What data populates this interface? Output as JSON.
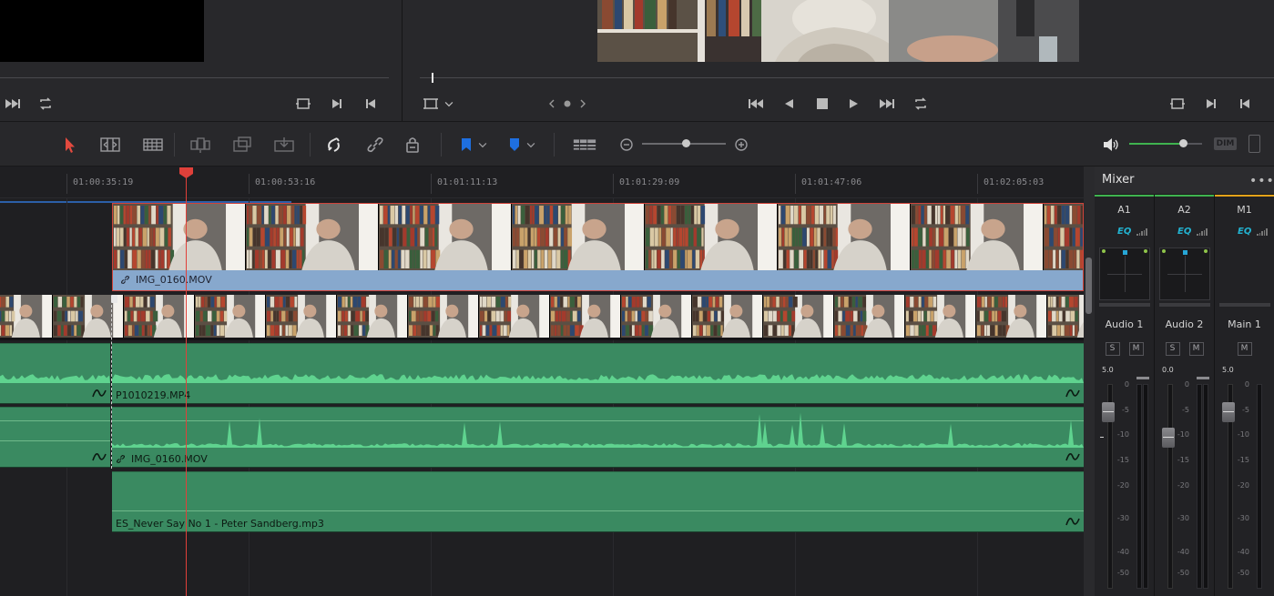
{
  "toolbar": {
    "tools": [
      {
        "name": "selection-mode-icon"
      },
      {
        "name": "trim-edit-mode-icon"
      },
      {
        "name": "dynamic-trim-mode-icon"
      },
      {
        "name": "blade-edit-mode-icon"
      },
      {
        "name": "insert-clip-icon"
      },
      {
        "name": "overwrite-clip-icon"
      },
      {
        "name": "replace-clip-icon"
      },
      {
        "name": "snapping-icon"
      },
      {
        "name": "linked-selection-icon"
      },
      {
        "name": "position-lock-icon"
      },
      {
        "name": "flag-icon"
      },
      {
        "name": "marker-icon"
      },
      {
        "name": "timeline-view-options-icon"
      },
      {
        "name": "zoom-out-icon"
      },
      {
        "name": "zoom-in-icon"
      },
      {
        "name": "speaker-icon"
      }
    ],
    "dim_label": "DIM",
    "zoom_level": 0.5,
    "volume_level": 0.74
  },
  "timeline": {
    "ruler_timecodes": [
      "01:00:35:19",
      "01:00:53:16",
      "01:01:11:13",
      "01:01:29:09",
      "01:01:47:06",
      "01:02:05:03"
    ],
    "video_clips": [
      {
        "name": "IMG_0160.MOV"
      }
    ],
    "audio_clips": [
      {
        "name": "P1010219.MP4"
      },
      {
        "name": "IMG_0160.MOV"
      },
      {
        "name": "ES_Never Say No 1 - Peter Sandberg.mp3"
      }
    ]
  },
  "mixer": {
    "title": "Mixer",
    "menu_label": "•••",
    "channels": [
      {
        "id": "A1",
        "name": "Audio 1",
        "eq": "EQ",
        "solo": "S",
        "mute": "M",
        "value": "5.0",
        "accent": "#3fb34f"
      },
      {
        "id": "A2",
        "name": "Audio 2",
        "eq": "EQ",
        "solo": "S",
        "mute": "M",
        "value": "0.0",
        "accent": "#3fb34f"
      },
      {
        "id": "M1",
        "name": "Main 1",
        "eq": "EQ",
        "mute": "M",
        "value": "5.0",
        "accent": "#e3a21a"
      }
    ],
    "scale": [
      "0",
      "-5",
      "-10",
      "-15",
      "-20",
      "-30",
      "-40",
      "-50"
    ]
  },
  "colors": {
    "playhead": "#e0403a",
    "video_clip_bar": "#87a8cd",
    "audio_clip": "#3a8a61",
    "eq_text": "#22b2d0"
  }
}
